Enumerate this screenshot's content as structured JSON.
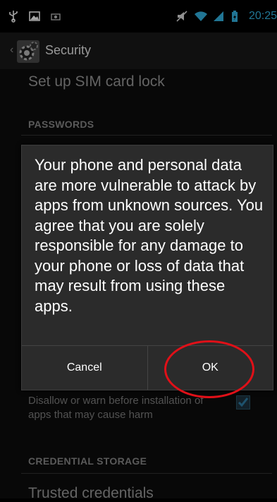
{
  "status_bar": {
    "left_icons": [
      "usb-icon",
      "picture-icon",
      "camera-icon"
    ],
    "right_icons": [
      "mute-icon",
      "wifi-icon",
      "signal-icon",
      "battery-icon"
    ],
    "clock": "20:25",
    "accent_color": "#33b5e5"
  },
  "action_bar": {
    "title": "Security",
    "icon": "settings-gear-icon"
  },
  "list": {
    "sim_lock": "Set up SIM card lock",
    "passwords_header": "PASSWORDS",
    "verify_apps_summary": "Disallow or warn before installation of apps that may cause harm",
    "verify_apps_checked": true,
    "credential_header": "CREDENTIAL STORAGE",
    "trusted_credentials": "Trusted credentials"
  },
  "dialog": {
    "message": "Your phone and personal data are more vulnerable to attack by apps from unknown sources. You agree that you are solely responsible for any damage to your phone or loss of data that may result from using these apps.",
    "cancel_label": "Cancel",
    "ok_label": "OK"
  },
  "annotation_color": "#e01018"
}
